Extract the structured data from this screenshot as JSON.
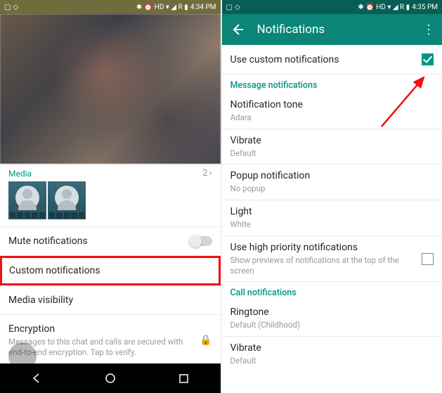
{
  "left": {
    "status": {
      "time": "4:34 PM",
      "icons": "✱ ⏰ HD ▾ ◢ R ▮"
    },
    "media": {
      "label": "Media",
      "count": "2"
    },
    "rows": {
      "mute": "Mute notifications",
      "custom": "Custom notifications",
      "media_vis": "Media visibility",
      "encryption": {
        "title": "Encryption",
        "sub": "Messages to this chat and calls are secured with end-to-end encryption. Tap to verify."
      }
    }
  },
  "right": {
    "status": {
      "time": "4:35 PM",
      "icons": "✱ ⏰ HD ▾ ◢ R ▮"
    },
    "topbar": {
      "title": "Notifications"
    },
    "use_custom": "Use custom notifications",
    "cat_msg": "Message notifications",
    "tone": {
      "title": "Notification tone",
      "sub": "Adara"
    },
    "vibrate": {
      "title": "Vibrate",
      "sub": "Default"
    },
    "popup": {
      "title": "Popup notification",
      "sub": "No popup"
    },
    "light": {
      "title": "Light",
      "sub": "White"
    },
    "priority": {
      "title": "Use high priority notifications",
      "sub": "Show previews of notifications at the top of the screen"
    },
    "cat_call": "Call notifications",
    "ringtone": {
      "title": "Ringtone",
      "sub": "Default (Childhood)"
    },
    "vibrate2": {
      "title": "Vibrate",
      "sub": "Default"
    }
  }
}
